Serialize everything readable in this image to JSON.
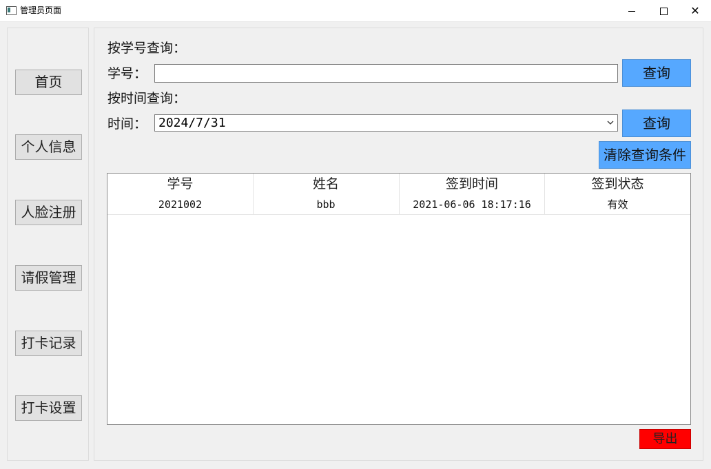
{
  "window": {
    "title": "管理员页面",
    "icon": "app-window-icon",
    "controls": [
      "minimize-icon",
      "maximize-icon",
      "close-icon"
    ],
    "close_glyph": "✕"
  },
  "nav": {
    "items": [
      {
        "label": "首页"
      },
      {
        "label": "个人信息"
      },
      {
        "label": "人脸注册"
      },
      {
        "label": "请假管理"
      },
      {
        "label": "打卡记录"
      },
      {
        "label": "打卡设置"
      }
    ]
  },
  "search": {
    "by_id_heading": "按学号查询：",
    "id_label": "学号：",
    "id_value": "",
    "query_label": "查询",
    "by_time_heading": "按时间查询：",
    "time_label": "时间：",
    "date_value": "2024/7/31",
    "clear_label": "清除查询条件"
  },
  "table": {
    "columns": [
      "学号",
      "姓名",
      "签到时间",
      "签到状态"
    ],
    "rows": [
      [
        "2021002",
        "bbb",
        "2021-06-06 18:17:16",
        "有效"
      ]
    ]
  },
  "export_label": "导出",
  "colors": {
    "query_button": "#56a8ff",
    "export_button": "#ff0000",
    "background": "#f0f0f0"
  }
}
